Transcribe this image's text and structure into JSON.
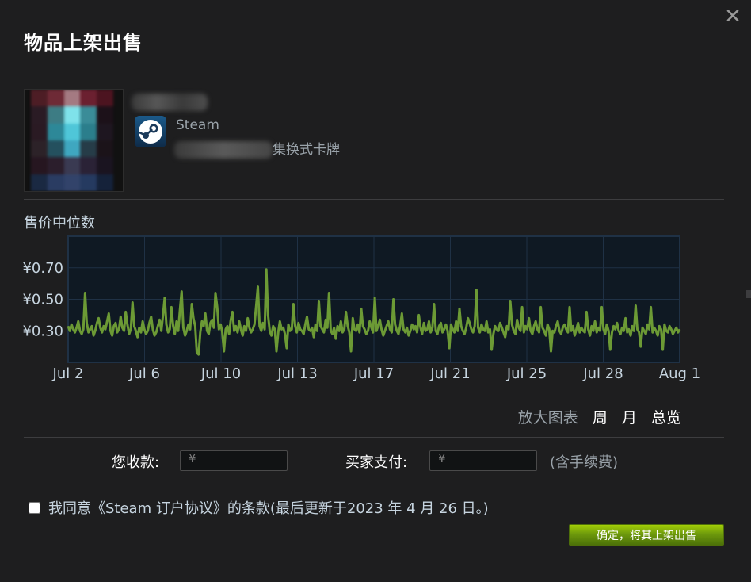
{
  "dialog": {
    "title": "物品上架出售",
    "close_icon": "close-icon"
  },
  "item": {
    "game": "Steam",
    "type_suffix": "集换式卡牌",
    "steam_icon": "steam-logo-icon",
    "mosaic": [
      "#4d1d25",
      "#6e2a36",
      "#a47a82",
      "#6b2030",
      "#4c1420",
      "#2a1b24",
      "#3d7c84",
      "#7fe2ea",
      "#3a8c98",
      "#1c1119",
      "#2a1a23",
      "#2d8898",
      "#4fc6d8",
      "#2b7e8c",
      "#1e1620",
      "#2c2228",
      "#24505e",
      "#3fa7c0",
      "#263c48",
      "#1b1319",
      "#261620",
      "#2b1e2c",
      "#3a3a52",
      "#2a2236",
      "#1a1420",
      "#1a2942",
      "#2a3c62",
      "#32436a",
      "#253a60",
      "#15223a"
    ]
  },
  "chart": {
    "title": "售价中位数",
    "colors": {
      "line": "#6c9a35",
      "plot_bg": "#0f1923",
      "grid": "#1f3145",
      "tick": "#c6d4df"
    }
  },
  "chart_data": {
    "type": "line",
    "title": "售价中位数",
    "xlabel": "",
    "ylabel": "",
    "x_ticks": [
      "Jul 2",
      "Jul 6",
      "Jul 10",
      "Jul 13",
      "Jul 17",
      "Jul 21",
      "Jul 25",
      "Jul 28",
      "Aug 1"
    ],
    "y_ticks": [
      "¥0.70",
      "¥0.50",
      "¥0.30"
    ],
    "y_tick_values": [
      0.7,
      0.5,
      0.3
    ],
    "ylim": [
      0.1,
      0.9
    ],
    "x_range": [
      "Jul 2",
      "Aug 1"
    ],
    "grid": true,
    "series": [
      {
        "values": [
          0.33,
          0.3,
          0.34,
          0.31,
          0.29,
          0.32,
          0.36,
          0.3,
          0.28,
          0.31,
          0.54,
          0.35,
          0.29,
          0.31,
          0.33,
          0.27,
          0.3,
          0.35,
          0.38,
          0.32,
          0.29,
          0.33,
          0.31,
          0.36,
          0.41,
          0.3,
          0.27,
          0.33,
          0.35,
          0.29,
          0.31,
          0.39,
          0.32,
          0.3,
          0.42,
          0.34,
          0.28,
          0.31,
          0.48,
          0.33,
          0.3,
          0.26,
          0.32,
          0.29,
          0.36,
          0.31,
          0.28,
          0.3,
          0.35,
          0.39,
          0.31,
          0.27,
          0.29,
          0.33,
          0.37,
          0.3,
          0.4,
          0.51,
          0.34,
          0.29,
          0.31,
          0.45,
          0.33,
          0.28,
          0.36,
          0.3,
          0.43,
          0.55,
          0.32,
          0.27,
          0.3,
          0.34,
          0.31,
          0.47,
          0.38,
          0.33,
          0.16,
          0.15,
          0.29,
          0.36,
          0.33,
          0.41,
          0.3,
          0.28,
          0.35,
          0.37,
          0.32,
          0.54,
          0.45,
          0.31,
          0.34,
          0.29,
          0.17,
          0.31,
          0.33,
          0.28,
          0.37,
          0.42,
          0.3,
          0.33,
          0.29,
          0.36,
          0.31,
          0.27,
          0.33,
          0.3,
          0.38,
          0.32,
          0.29,
          0.31,
          0.34,
          0.46,
          0.58,
          0.33,
          0.3,
          0.35,
          0.31,
          0.69,
          0.4,
          0.3,
          0.27,
          0.33,
          0.31,
          0.17,
          0.29,
          0.36,
          0.31,
          0.32,
          0.28,
          0.19,
          0.34,
          0.3,
          0.31,
          0.47,
          0.33,
          0.29,
          0.35,
          0.31,
          0.3,
          0.28,
          0.34,
          0.39,
          0.31,
          0.3,
          0.32,
          0.26,
          0.34,
          0.3,
          0.49,
          0.33,
          0.31,
          0.29,
          0.37,
          0.32,
          0.54,
          0.3,
          0.28,
          0.32,
          0.25,
          0.33,
          0.3,
          0.36,
          0.29,
          0.31,
          0.42,
          0.33,
          0.29,
          0.17,
          0.38,
          0.31,
          0.3,
          0.34,
          0.29,
          0.44,
          0.33,
          0.31,
          0.28,
          0.3,
          0.36,
          0.32,
          0.29,
          0.51,
          0.3,
          0.33,
          0.37,
          0.31,
          0.27,
          0.3,
          0.33,
          0.36,
          0.31,
          0.29,
          0.5,
          0.34,
          0.3,
          0.28,
          0.33,
          0.41,
          0.31,
          0.29,
          0.32,
          0.27,
          0.3,
          0.34,
          0.31,
          0.33,
          0.29,
          0.4,
          0.32,
          0.28,
          0.35,
          0.3,
          0.31,
          0.36,
          0.29,
          0.32,
          0.47,
          0.3,
          0.28,
          0.33,
          0.35,
          0.29,
          0.31,
          0.34,
          0.3,
          0.19,
          0.34,
          0.31,
          0.29,
          0.36,
          0.3,
          0.44,
          0.33,
          0.3,
          0.28,
          0.32,
          0.38,
          0.35,
          0.31,
          0.29,
          0.33,
          0.56,
          0.32,
          0.29,
          0.34,
          0.31,
          0.3,
          0.36,
          0.29,
          0.31,
          0.18,
          0.28,
          0.33,
          0.31,
          0.3,
          0.35,
          0.32,
          0.29,
          0.26,
          0.33,
          0.31,
          0.49,
          0.34,
          0.3,
          0.28,
          0.37,
          0.32,
          0.3,
          0.45,
          0.29,
          0.33,
          0.31,
          0.38,
          0.3,
          0.28,
          0.33,
          0.36,
          0.31,
          0.29,
          0.45,
          0.32,
          0.3,
          0.27,
          0.34,
          0.31,
          0.17,
          0.3,
          0.29,
          0.33,
          0.36,
          0.3,
          0.28,
          0.32,
          0.34,
          0.31,
          0.29,
          0.45,
          0.3,
          0.33,
          0.27,
          0.31,
          0.35,
          0.29,
          0.32,
          0.3,
          0.29,
          0.42,
          0.31,
          0.27,
          0.33,
          0.3,
          0.36,
          0.29,
          0.32,
          0.3,
          0.45,
          0.31,
          0.28,
          0.34,
          0.3,
          0.18,
          0.29,
          0.33,
          0.31,
          0.35,
          0.3,
          0.28,
          0.32,
          0.3,
          0.38,
          0.29,
          0.31,
          0.27,
          0.33,
          0.3,
          0.46,
          0.31,
          0.29,
          0.2,
          0.32,
          0.3,
          0.28,
          0.34,
          0.31,
          0.45,
          0.29,
          0.32,
          0.3,
          0.27,
          0.33,
          0.31,
          0.18,
          0.34,
          0.3,
          0.29,
          0.33,
          0.31,
          0.28,
          0.3,
          0.32,
          0.29,
          0.31
        ]
      }
    ]
  },
  "zoom": {
    "label": "放大图表",
    "week": "周",
    "month": "月",
    "all": "总览"
  },
  "pricing": {
    "receive_label": "您收款:",
    "receive_value": "¥",
    "buyer_label": "买家支付:",
    "buyer_value": "¥",
    "fee_note": "(含手续费)"
  },
  "agreement": {
    "checked": false,
    "text": "我同意《Steam 订户协议》的条款(最后更新于2023 年 4 月 26 日。)"
  },
  "actions": {
    "confirm": "确定，将其上架出售"
  }
}
